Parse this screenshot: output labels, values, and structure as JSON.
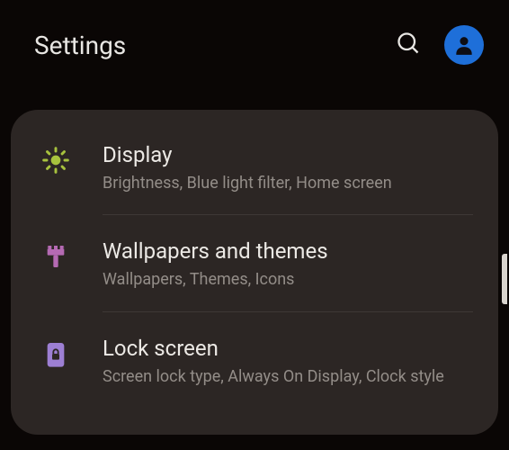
{
  "header": {
    "title": "Settings"
  },
  "items": [
    {
      "icon": "sun-icon",
      "title": "Display",
      "subtitle": "Brightness, Blue light filter, Home screen"
    },
    {
      "icon": "brush-icon",
      "title": "Wallpapers and themes",
      "subtitle": "Wallpapers, Themes, Icons"
    },
    {
      "icon": "lock-icon",
      "title": "Lock screen",
      "subtitle": "Screen lock type, Always On Display, Clock style"
    }
  ]
}
